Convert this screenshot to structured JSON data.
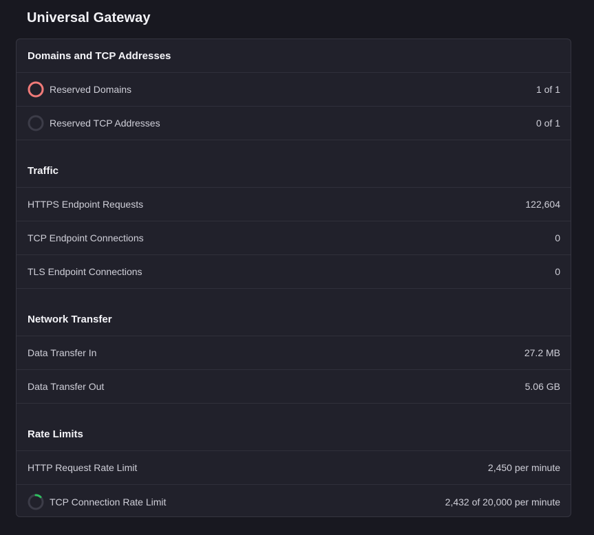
{
  "page_title": "Universal Gateway",
  "colors": {
    "background": "#181820",
    "card": "#21212b",
    "ring_full": "#f07a78",
    "ring_track": "#3c3c48",
    "ring_progress": "#2fbf5f"
  },
  "sections": {
    "domains": {
      "title": "Domains and TCP Addresses",
      "rows": [
        {
          "label": "Reserved Domains",
          "value": "1 of 1",
          "usage": 1.0,
          "icon": "usage-ring-icon"
        },
        {
          "label": "Reserved TCP Addresses",
          "value": "0 of 1",
          "usage": 0.0,
          "icon": "usage-ring-icon"
        }
      ]
    },
    "traffic": {
      "title": "Traffic",
      "rows": [
        {
          "label": "HTTPS Endpoint Requests",
          "value": "122,604"
        },
        {
          "label": "TCP Endpoint Connections",
          "value": "0"
        },
        {
          "label": "TLS Endpoint Connections",
          "value": "0"
        }
      ]
    },
    "network": {
      "title": "Network Transfer",
      "rows": [
        {
          "label": "Data Transfer In",
          "value": "27.2 MB"
        },
        {
          "label": "Data Transfer Out",
          "value": "5.06 GB"
        }
      ]
    },
    "rate_limits": {
      "title": "Rate Limits",
      "rows": [
        {
          "label": "HTTP Request Rate Limit",
          "value": "2,450 per minute"
        },
        {
          "label": "TCP Connection Rate Limit",
          "value": "2,432 of 20,000 per minute",
          "usage": 0.1216,
          "icon": "usage-ring-icon"
        }
      ]
    }
  }
}
